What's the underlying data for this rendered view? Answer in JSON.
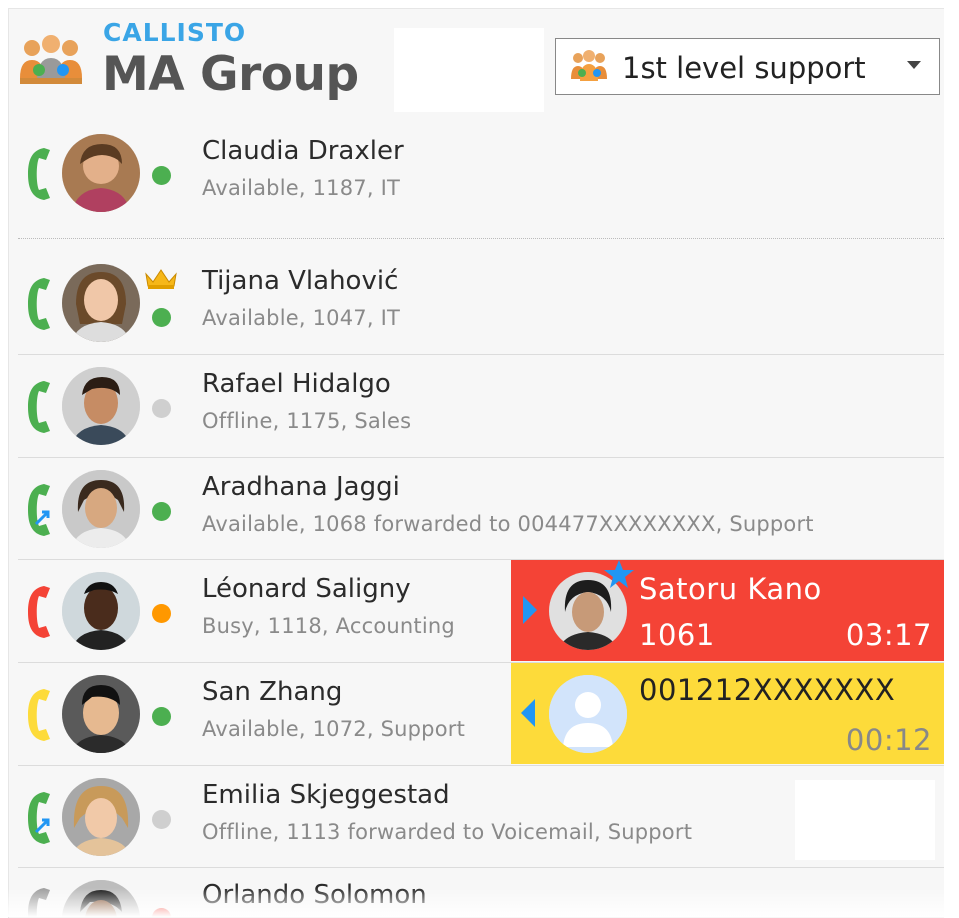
{
  "header": {
    "brand": "CALLISTO",
    "title": "MA Group",
    "logo_icon": "group-people-icon"
  },
  "group_selector": {
    "label": "1st level support",
    "icon": "group-people-icon"
  },
  "colors": {
    "available": "#4caf50",
    "offline": "#cfcfcf",
    "busy": "#ff9800",
    "incoming_call_bg": "#f44336",
    "outgoing_call_bg": "#fddb3a",
    "phone_green": "#4caf50",
    "phone_red": "#f44336",
    "phone_yellow": "#fddb3a",
    "accent_blue": "#2196f3"
  },
  "contacts": [
    {
      "name": "Claudia Draxler",
      "status": "Available, 1187, IT"
    },
    {
      "name": "Tijana Vlahović",
      "status": "Available, 1047, IT"
    },
    {
      "name": "Rafael Hidalgo",
      "status": "Offline, 1175, Sales"
    },
    {
      "name": "Aradhana Jaggi",
      "status": "Available, 1068 forwarded to 004477XXXXXXXX, Support"
    },
    {
      "name": "Léonard Saligny",
      "status": "Busy, 1118, Accounting"
    },
    {
      "name": "San Zhang",
      "status": "Available, 1072, Support"
    },
    {
      "name": "Emilia Skjeggestad",
      "status": "Offline, 1113 forwarded to Voicemail, Support"
    },
    {
      "name": "Orlando Solomon",
      "status": ""
    }
  ],
  "calls": {
    "incoming": {
      "name": "Satoru Kano",
      "number": "1061",
      "duration": "03:17"
    },
    "outgoing": {
      "number": "001212XXXXXXX",
      "duration": "00:12"
    }
  }
}
